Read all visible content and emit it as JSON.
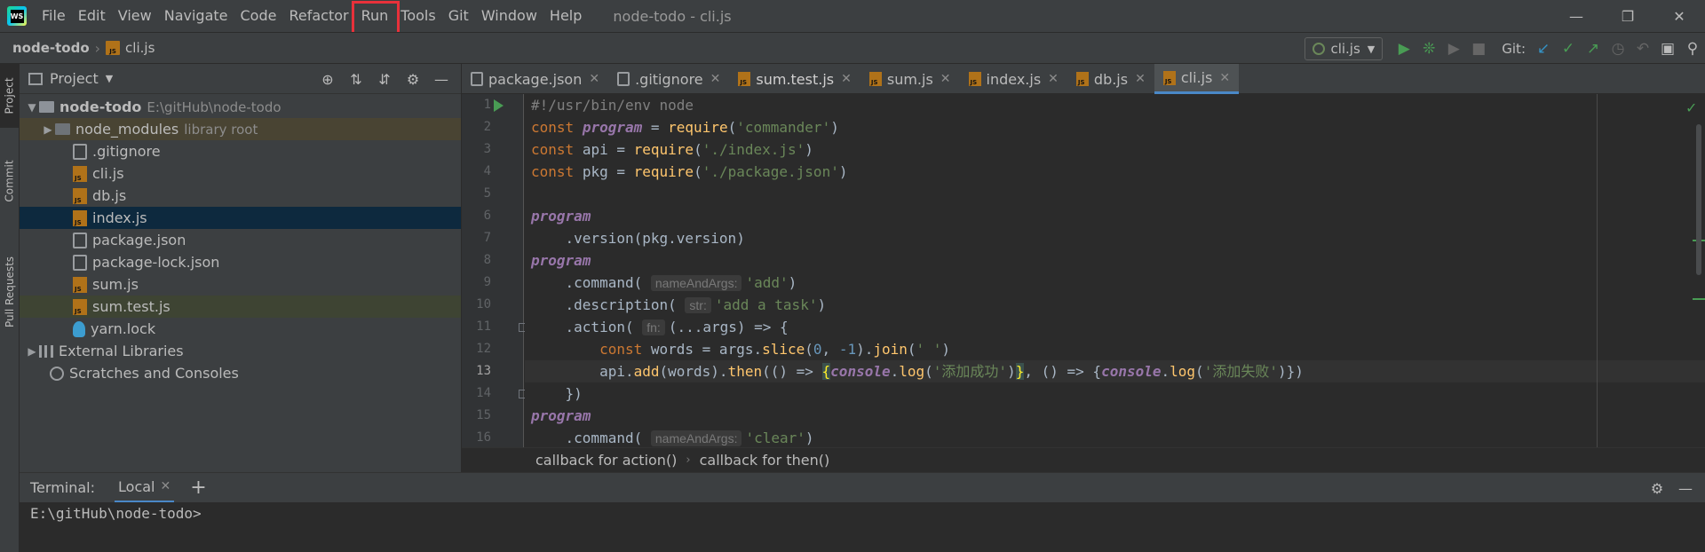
{
  "menubar": {
    "logo_text": "WS",
    "items": [
      "File",
      "Edit",
      "View",
      "Navigate",
      "Code",
      "Refactor",
      "Run",
      "Tools",
      "Git",
      "Window",
      "Help"
    ],
    "highlighted_item": "Run",
    "window_title": "node-todo - cli.js",
    "controls": [
      "minimize-icon",
      "restore-icon",
      "close-icon"
    ]
  },
  "navbar": {
    "project": "node-todo",
    "file": "cli.js",
    "run_config": "cli.js",
    "git_label": "Git:"
  },
  "stripe": {
    "tabs": [
      "Project",
      "Commit",
      "Pull Requests"
    ]
  },
  "project_panel": {
    "title": "Project",
    "tree": [
      {
        "label": "node-todo",
        "hint": "E:\\gitHub\\node-todo",
        "type": "folder-open",
        "indent": 0
      },
      {
        "label": "node_modules",
        "hint": "library root",
        "type": "folder-closed",
        "indent": 1
      },
      {
        "label": ".gitignore",
        "hint": "",
        "type": "config",
        "indent": 2
      },
      {
        "label": "cli.js",
        "hint": "",
        "type": "js",
        "indent": 2
      },
      {
        "label": "db.js",
        "hint": "",
        "type": "js",
        "indent": 2
      },
      {
        "label": "index.js",
        "hint": "",
        "type": "js",
        "indent": 2
      },
      {
        "label": "package.json",
        "hint": "",
        "type": "config",
        "indent": 2
      },
      {
        "label": "package-lock.json",
        "hint": "",
        "type": "config",
        "indent": 2
      },
      {
        "label": "sum.js",
        "hint": "",
        "type": "js",
        "indent": 2
      },
      {
        "label": "sum.test.js",
        "hint": "",
        "type": "js",
        "indent": 2
      },
      {
        "label": "yarn.lock",
        "hint": "",
        "type": "yarn",
        "indent": 2
      },
      {
        "label": "External Libraries",
        "hint": "",
        "type": "lib",
        "indent": 0
      },
      {
        "label": "Scratches and Consoles",
        "hint": "",
        "type": "scratch",
        "indent": 0
      }
    ]
  },
  "editor": {
    "tabs": [
      {
        "label": "package.json",
        "icon": "config"
      },
      {
        "label": ".gitignore",
        "icon": "config"
      },
      {
        "label": "sum.test.js",
        "icon": "js"
      },
      {
        "label": "sum.js",
        "icon": "js"
      },
      {
        "label": "index.js",
        "icon": "js"
      },
      {
        "label": "db.js",
        "icon": "js"
      },
      {
        "label": "cli.js",
        "icon": "js",
        "active": true
      }
    ],
    "line_numbers": [
      "1",
      "2",
      "3",
      "4",
      "5",
      "6",
      "7",
      "8",
      "9",
      "10",
      "11",
      "12",
      "13",
      "14",
      "15",
      "16"
    ],
    "current_line": "13",
    "code": {
      "l1": "#!/usr/bin/env node",
      "kw_const": "const",
      "v_program": "program",
      "v_api": "api",
      "v_pkg": "pkg",
      "eq": " = ",
      "require": "require",
      "s_commander": "'commander'",
      "s_index": "'./index.js'",
      "s_package": "'./package.json'",
      "version_call": "    .version(pkg.version)",
      "dot_command": "    .command(",
      "dot_description": "    .description(",
      "dot_action": "    .action(",
      "hint_nameAndArgs": "nameAndArgs:",
      "hint_str": "str:",
      "hint_fn": "fn:",
      "s_add": "'add'",
      "s_add_task": "'add a task'",
      "s_clear": "'clear'",
      "action_args": "(...args) => {",
      "l12_a": "        ",
      "l12_b": " words = args.",
      "slice": "slice",
      "l12_c": "(",
      "n0": "0",
      "l12_d": ", ",
      "nm1": "-1",
      "l12_e": ").",
      "join": "join",
      "l12_f": "(",
      "s_space": "' '",
      "l12_g": ")",
      "l13_a": "        api.",
      "add": "add",
      "l13_b": "(words).",
      "then": "then",
      "l13_c": "(() => ",
      "brace_open": "{",
      "console": "console",
      "log": "log",
      "s_success": "'添加成功'",
      "brace_close": "}",
      "l13_d": ", () => {",
      "s_fail": "'添加失败'",
      "l13_e": ")})",
      "close_paren": ")",
      "close_action": "    })",
      "paren_open": "(",
      "dot": "."
    },
    "breadcrumbs": [
      "callback for action()",
      "callback for then()"
    ]
  },
  "terminal": {
    "title": "Terminal:",
    "tab": "Local",
    "prompt": "E:\\gitHub\\node-todo>"
  },
  "colors": {
    "highlight_box": "#e8313a",
    "accent": "#4a88c7",
    "run_green": "#499c54"
  }
}
